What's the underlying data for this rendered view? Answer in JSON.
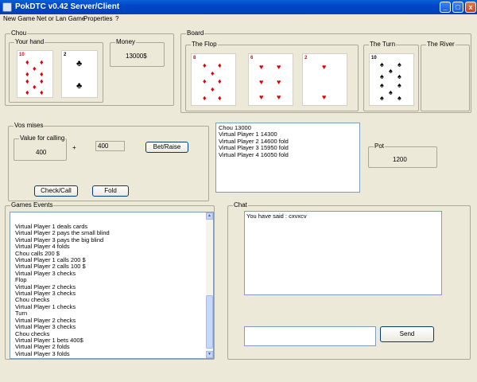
{
  "window": {
    "title": "PokDTC v0.42 Server/Client",
    "minimize": "_",
    "maximize": "□",
    "close": "x"
  },
  "menu": [
    "New Game",
    "Net or Lan Game",
    "Properties",
    "?"
  ],
  "player": {
    "group": "Chou",
    "hand_label": "Your hand",
    "money_label": "Money",
    "money_value": "13000$",
    "cards": [
      {
        "rank": "10",
        "suit": "♦",
        "color": "red"
      },
      {
        "rank": "2",
        "suit": "♣",
        "color": "black"
      }
    ]
  },
  "board": {
    "group": "Board",
    "flop_label": "The Flop",
    "turn_label": "The Turn",
    "river_label": "The River",
    "flop": [
      {
        "rank": "8",
        "suit": "♦",
        "color": "red"
      },
      {
        "rank": "6",
        "suit": "♥",
        "color": "red"
      },
      {
        "rank": "2",
        "suit": "♥",
        "color": "red"
      }
    ],
    "turn": {
      "rank": "10",
      "suit": "♠",
      "color": "black"
    }
  },
  "bets": {
    "group": "Vos mises",
    "value_label": "Value for calling",
    "value": "400",
    "plus": "+",
    "raise_amount": "400",
    "bet_raise": "Bet/Raise",
    "check_call": "Check/Call",
    "fold": "Fold"
  },
  "players_list": [
    "Chou 13000",
    "Virtual Player 1 14300",
    "Virtual Player 2 14600 fold",
    "Virtual Player 3 15950 fold",
    "Virtual Player 4 16050 fold"
  ],
  "pot": {
    "label": "Pot",
    "value": "1200"
  },
  "events": {
    "group": "Games Events",
    "lines": [
      "Virtual Player 1 deals cards",
      "Virtual Player 2 pays the small blind",
      "Virtual Player 3 pays the big blind",
      "Virtual Player 4 folds",
      "Chou calls 200 $",
      "Virtual Player 1 calls 200 $",
      "Virtual Player 2 calls 100 $",
      "Virtual Player 3 checks",
      "Flop",
      "Virtual Player 2 checks",
      "Virtual Player 3 checks",
      "Chou checks",
      "Virtual Player 1 checks",
      "Turn",
      "Virtual Player 2 checks",
      "Virtual Player 3 checks",
      "Chou checks",
      "Virtual Player 1 bets 400$",
      "Virtual Player 2 folds",
      "Virtual Player 3 folds"
    ]
  },
  "chat": {
    "group": "Chat",
    "messages": [
      "You have said : cxvxcv"
    ],
    "input_value": "",
    "send": "Send"
  }
}
